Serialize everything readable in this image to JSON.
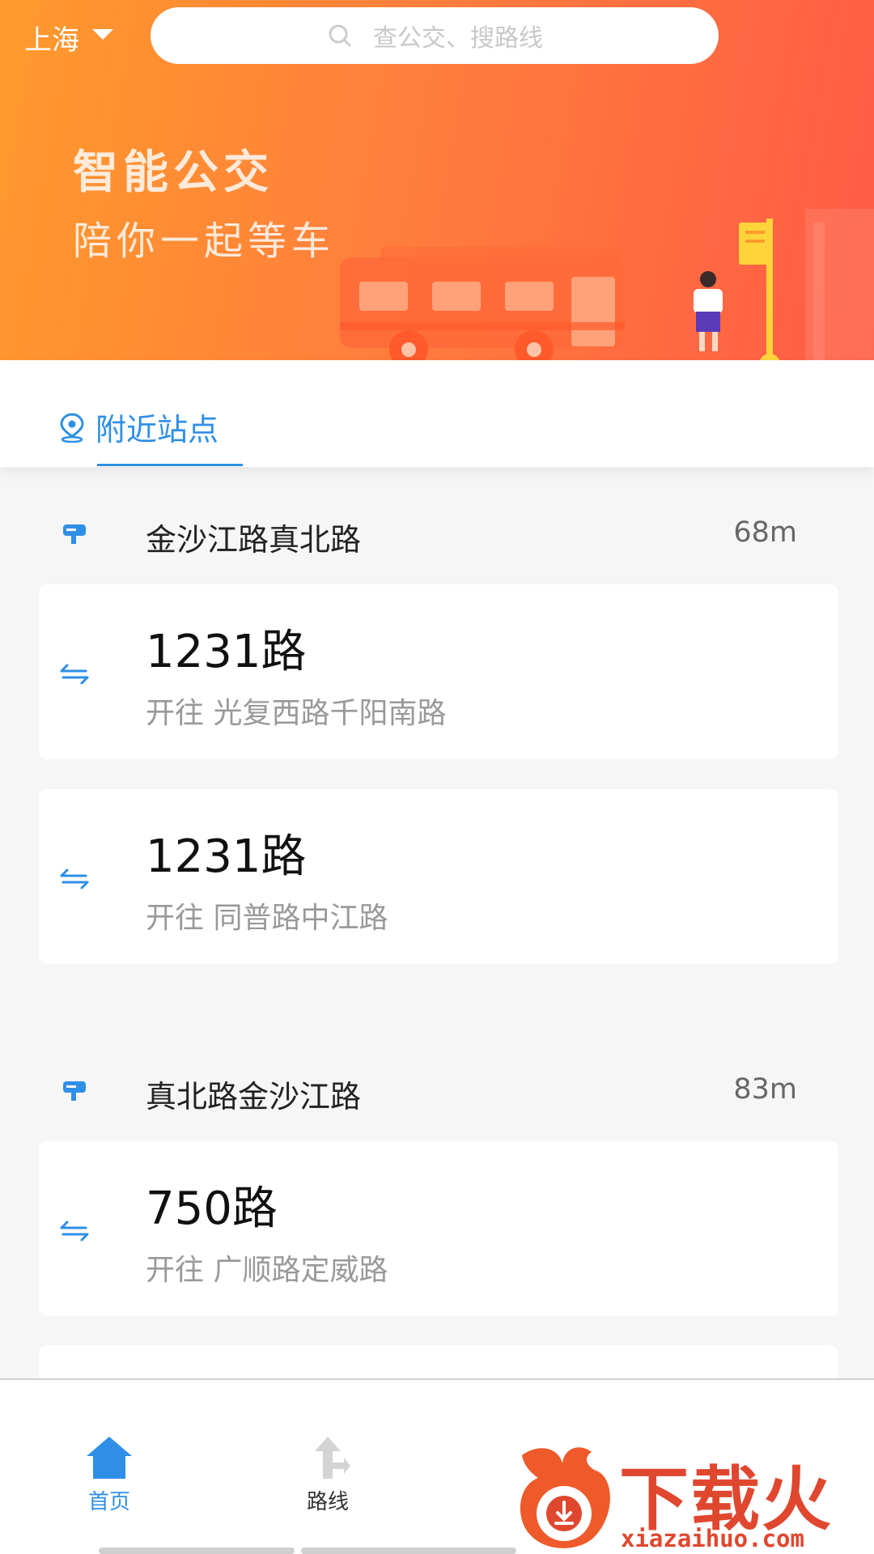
{
  "header": {
    "city": "上海",
    "search_placeholder": "查公交、搜路线",
    "slogan_line1": "智能公交",
    "slogan_line2": "陪你一起等车"
  },
  "tabs": [
    {
      "label": "附近站点",
      "active": true
    }
  ],
  "stations": [
    {
      "name": "金沙江路真北路",
      "distance": "68m",
      "lines": [
        {
          "number": "1231路",
          "direction": "开往 光复西路千阳南路"
        },
        {
          "number": "1231路",
          "direction": "开往 同普路中江路"
        }
      ]
    },
    {
      "name": "真北路金沙江路",
      "distance": "83m",
      "lines": [
        {
          "number": "750路",
          "direction": "开往 广顺路定威路"
        }
      ]
    }
  ],
  "bottom_nav": [
    {
      "label": "首页",
      "icon": "home-icon",
      "active": true
    },
    {
      "label": "路线",
      "icon": "route-icon",
      "active": false
    }
  ],
  "watermark": {
    "text": "下载火",
    "url": "xiazaihuo.com"
  },
  "colors": {
    "accent_blue": "#2f8fe6",
    "banner_start": "#ff9a2c",
    "banner_end": "#ff5b45",
    "watermark_red": "#e0472f"
  }
}
